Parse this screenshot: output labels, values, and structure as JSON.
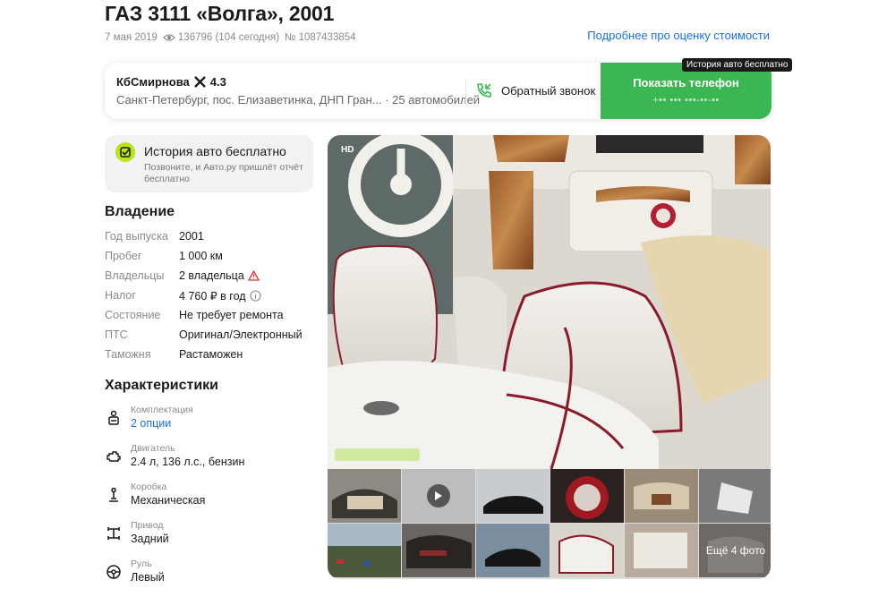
{
  "listing": {
    "title": "ГАЗ 3111 «Волга», 2001",
    "date": "7 мая 2019",
    "views": "136796 (104 сегодня)",
    "id": "№ 1087433854",
    "estimate_link": "Подробнее про оценку стоимости"
  },
  "seller": {
    "name": "КбСмирнова",
    "rating": "4.3",
    "address": "Санкт-Петербург, пос. Елизаветинка, ДНП Гран... · 25 автомобилей",
    "callback_label": "Обратный звонок",
    "show_phone_label": "Показать телефон",
    "phone_mask": "+•• ••• •••-••-••",
    "tooltip": "История авто бесплатно"
  },
  "history_promo": {
    "title": "История авто бесплатно",
    "subtitle": "Позвоните, и Авто.ру пришлёт отчёт бесплатно"
  },
  "ownership": {
    "title": "Владение",
    "rows": [
      {
        "key": "Год выпуска",
        "value": "2001"
      },
      {
        "key": "Пробег",
        "value": "1 000 км"
      },
      {
        "key": "Владельцы",
        "value": "2 владельца"
      },
      {
        "key": "Налог",
        "value": "4 760 ₽ в год"
      },
      {
        "key": "Состояние",
        "value": "Не требует ремонта"
      },
      {
        "key": "ПТС",
        "value": "Оригинал/Электронный"
      },
      {
        "key": "Таможня",
        "value": "Растаможен"
      }
    ]
  },
  "characteristics": {
    "title": "Характеристики",
    "items": [
      {
        "label": "Комплектация",
        "value": "2 опции",
        "icon": "seat-icon"
      },
      {
        "label": "Двигатель",
        "value": "2.4 л, 136 л.с., бензин",
        "icon": "engine-icon"
      },
      {
        "label": "Коробка",
        "value": "Механическая",
        "icon": "gear-lever-icon"
      },
      {
        "label": "Привод",
        "value": "Задний",
        "icon": "drive-axle-icon"
      },
      {
        "label": "Руль",
        "value": "Левый",
        "icon": "steering-wheel-icon"
      }
    ]
  },
  "gallery": {
    "hd_badge": "HD",
    "more_photos": "Ещё 4 фото"
  },
  "colors": {
    "accent_green": "#3cb652",
    "link_blue": "#1b6fe0",
    "warning_red": "#e03030",
    "history_lime": "#b9e516"
  }
}
